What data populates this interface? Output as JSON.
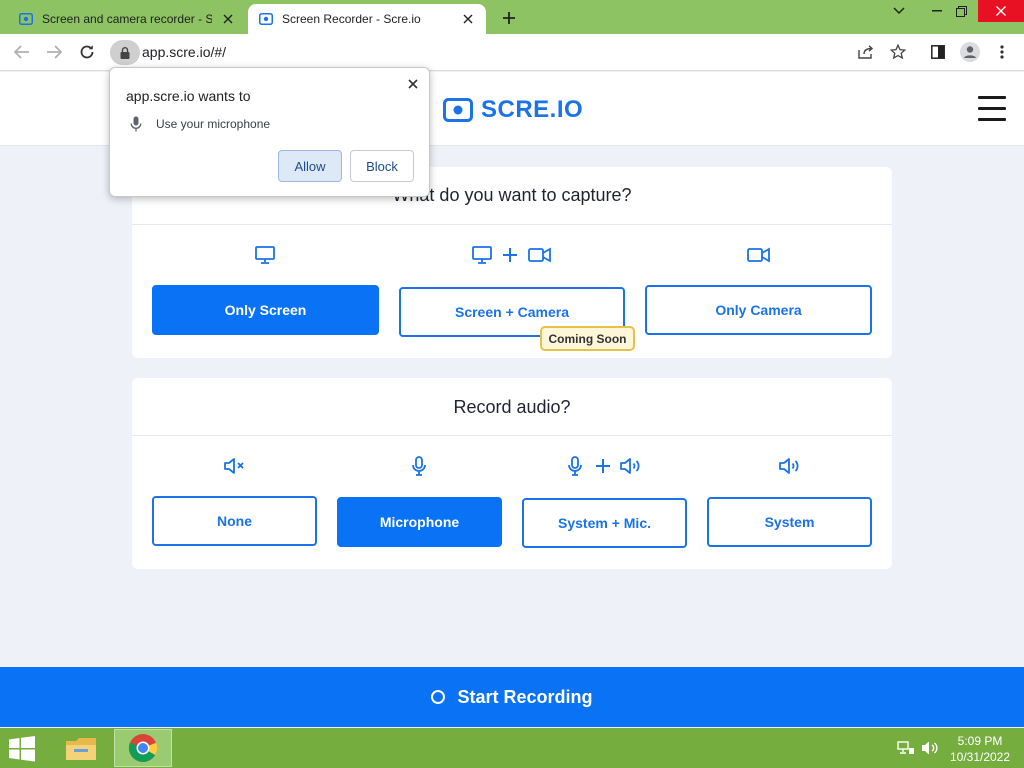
{
  "browser": {
    "tabs": [
      {
        "title": "Screen and camera recorder - Sc",
        "favicon": "screen-recorder-favicon",
        "active": false
      },
      {
        "title": "Screen Recorder - Scre.io",
        "favicon": "screen-recorder-favicon",
        "active": true
      }
    ],
    "url": "app.scre.io/#/"
  },
  "header": {
    "logo_text": "SCRE.IO",
    "brand_color": "#1a73e8"
  },
  "capture": {
    "title": "What do you want to capture?",
    "options": [
      {
        "label": "Only Screen",
        "icon": "monitor-icon",
        "selected": true
      },
      {
        "label": "Screen + Camera",
        "icon": "monitor-plus-camera-icon",
        "selected": false
      },
      {
        "label": "Only Camera",
        "icon": "camera-icon",
        "selected": false
      }
    ],
    "badge": "Coming Soon"
  },
  "audio": {
    "title": "Record audio?",
    "options": [
      {
        "label": "None",
        "icon": "mute-icon",
        "selected": false
      },
      {
        "label": "Microphone",
        "icon": "microphone-icon",
        "selected": true
      },
      {
        "label": "System + Mic.",
        "icon": "mic-plus-speaker-icon",
        "selected": false
      },
      {
        "label": "System",
        "icon": "speaker-icon",
        "selected": false
      }
    ]
  },
  "start": {
    "label": "Start Recording"
  },
  "permission_popup": {
    "title": "app.scre.io wants to",
    "request": "Use your microphone",
    "allow_label": "Allow",
    "block_label": "Block"
  },
  "taskbar": {
    "time": "5:09 PM",
    "date": "10/31/2022"
  }
}
